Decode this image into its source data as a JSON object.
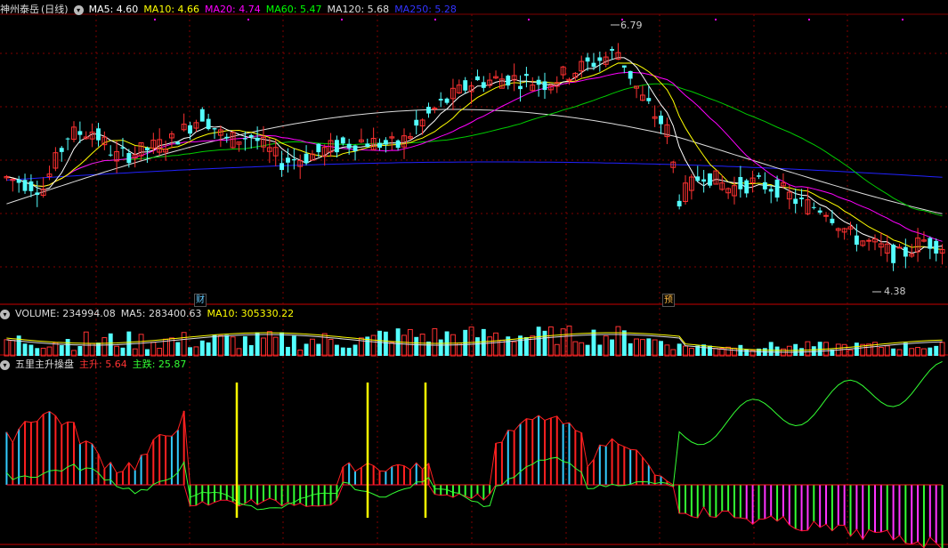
{
  "stock": {
    "name": "神州泰岳",
    "period": "(日线)"
  },
  "price_panel": {
    "ma_labels": [
      {
        "text": "MA5: 4.60",
        "color": "#ffffff"
      },
      {
        "text": "MA10: 4.66",
        "color": "#ffff00"
      },
      {
        "text": "MA20: 4.74",
        "color": "#ff00ff"
      },
      {
        "text": "MA60: 5.47",
        "color": "#00ff00"
      },
      {
        "text": "MA120: 5.68",
        "color": "#dddddd"
      },
      {
        "text": "MA250: 5.28",
        "color": "#3333ff"
      }
    ],
    "high_label": "6.79",
    "low_label": "4.38",
    "event_tags": [
      "财",
      "预"
    ]
  },
  "volume_panel": {
    "labels": [
      {
        "text": "VOLUME: 234994.08",
        "color": "#dddddd"
      },
      {
        "text": "MA5: 283400.63",
        "color": "#dddddd"
      },
      {
        "text": "MA10: 305330.22",
        "color": "#ffff00"
      }
    ]
  },
  "indicator_panel": {
    "name": "五里主升操盘",
    "labels": [
      {
        "text": "主升: 5.64",
        "color": "#ff3333"
      },
      {
        "text": "主跌: 25.87",
        "color": "#33ff33"
      }
    ]
  },
  "colors": {
    "up": "#ff3232",
    "down": "#54ffff",
    "grid": "#8b0000"
  },
  "icons": [
    "chevron-down-icon"
  ]
}
